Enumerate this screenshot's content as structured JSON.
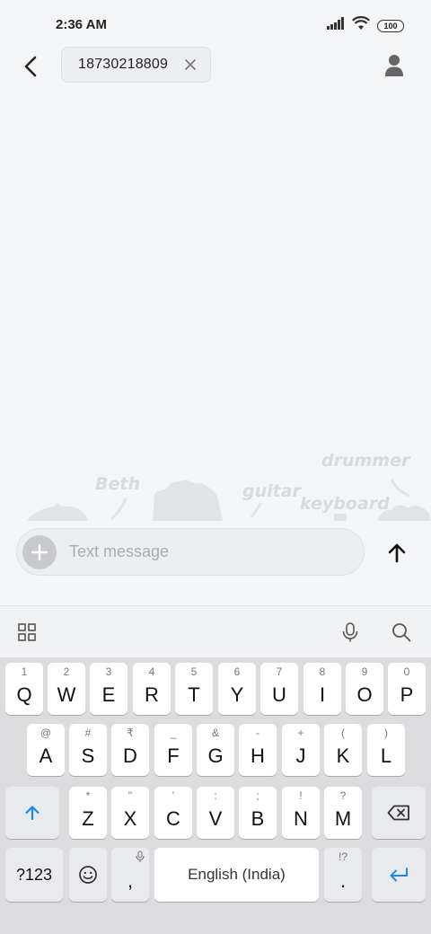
{
  "status_bar": {
    "time": "2:36 AM",
    "battery": "100"
  },
  "top_bar": {
    "recipient": "18730218809"
  },
  "illustration": {
    "words": [
      "Beth",
      "guitar",
      "drummer",
      "keyboard"
    ]
  },
  "compose": {
    "placeholder": "Text message"
  },
  "keyboard": {
    "row1": [
      {
        "hint": "1",
        "key": "Q"
      },
      {
        "hint": "2",
        "key": "W"
      },
      {
        "hint": "3",
        "key": "E"
      },
      {
        "hint": "4",
        "key": "R"
      },
      {
        "hint": "5",
        "key": "T"
      },
      {
        "hint": "6",
        "key": "Y"
      },
      {
        "hint": "7",
        "key": "U"
      },
      {
        "hint": "8",
        "key": "I"
      },
      {
        "hint": "9",
        "key": "O"
      },
      {
        "hint": "0",
        "key": "P"
      }
    ],
    "row2": [
      {
        "hint": "@",
        "key": "A"
      },
      {
        "hint": "#",
        "key": "S"
      },
      {
        "hint": "₹",
        "key": "D"
      },
      {
        "hint": "_",
        "key": "F"
      },
      {
        "hint": "&",
        "key": "G"
      },
      {
        "hint": "-",
        "key": "H"
      },
      {
        "hint": "+",
        "key": "J"
      },
      {
        "hint": "(",
        "key": "K"
      },
      {
        "hint": ")",
        "key": "L"
      }
    ],
    "row3": [
      {
        "hint": "*",
        "key": "Z"
      },
      {
        "hint": "\"",
        "key": "X"
      },
      {
        "hint": "'",
        "key": "C"
      },
      {
        "hint": ":",
        "key": "V"
      },
      {
        "hint": ";",
        "key": "B"
      },
      {
        "hint": "!",
        "key": "N"
      },
      {
        "hint": "?",
        "key": "M"
      }
    ],
    "symbols_label": "?123",
    "comma": ",",
    "space_label": "English (India)",
    "period_hint": "!?",
    "period": "."
  },
  "colors": {
    "accent": "#1e88e5",
    "background": "#f4f5f7",
    "keyboard_bg": "#dcdcdf"
  }
}
